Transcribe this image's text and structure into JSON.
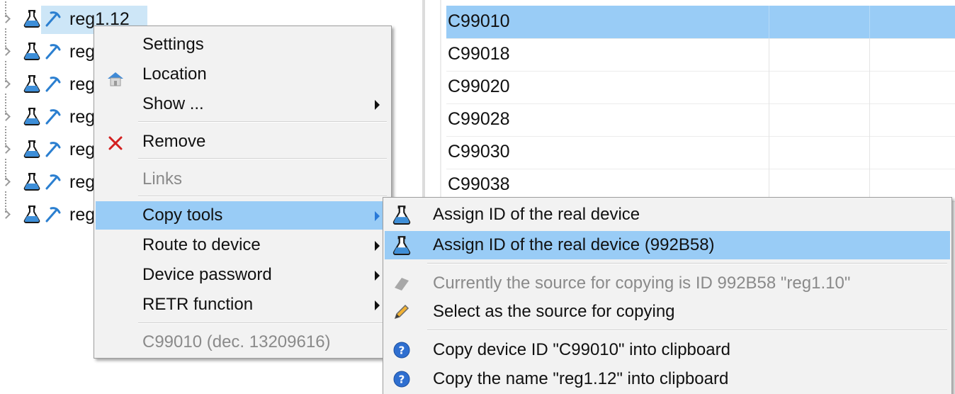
{
  "tree": {
    "items": [
      {
        "label": "reg1.12"
      },
      {
        "label": "reg"
      },
      {
        "label": "reg"
      },
      {
        "label": "reg"
      },
      {
        "label": "reg"
      },
      {
        "label": "reg"
      },
      {
        "label": "reg"
      }
    ]
  },
  "grid": {
    "rows": [
      "C99010",
      "C99018",
      "C99020",
      "C99028",
      "C99030",
      "C99038"
    ]
  },
  "context_menu": {
    "settings": "Settings",
    "location": "Location",
    "show": "Show ...",
    "remove": "Remove",
    "links": "Links",
    "copy_tools": "Copy tools",
    "route_to_device": "Route to device",
    "device_password": "Device password",
    "retr_function": "RETR function",
    "device_id_info": "C99010 (dec. 13209616)"
  },
  "submenu": {
    "assign_id": "Assign ID of the real device",
    "assign_id_specific": "Assign ID of the real device (992B58)",
    "current_source": "Currently the source for copying is ID 992B58 \"reg1.10\"",
    "select_source": "Select as the source for copying",
    "copy_device_id": "Copy device ID \"C99010\" into clipboard",
    "copy_name": "Copy the name \"reg1.12\" into clipboard"
  },
  "colors": {
    "highlight": "#99ccf6",
    "tree_selection": "#cde6f7",
    "menu_background": "#f2f2f2",
    "disabled_text": "#8a8a8a",
    "remove_icon": "#d32020",
    "help_icon": "#2f6fd0"
  },
  "icons": {
    "tree_item": [
      "expander-chevron-icon",
      "flask-icon",
      "pickaxe-icon"
    ],
    "location": "house-icon",
    "remove": "close-x-icon",
    "assign_id": "flask-icon",
    "current_source": "eraser-icon",
    "select_source": "pencil-icon",
    "clipboard": "help-circle-icon"
  }
}
